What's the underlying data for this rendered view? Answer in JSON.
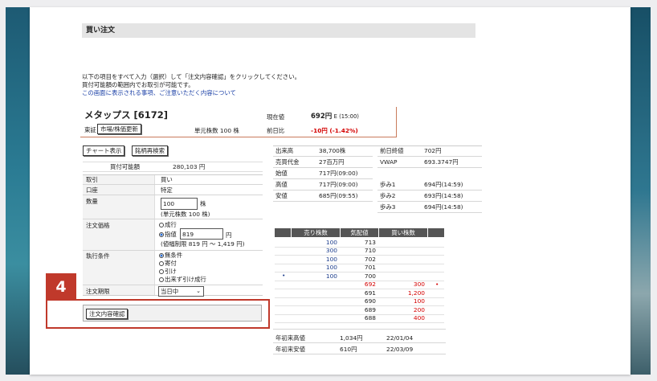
{
  "title": "買い注文",
  "intro": {
    "line1": "以下の項目をすべて入力（選択）して「注文内容確認」をクリックしてください。",
    "line2": "買付可能額の範囲内でお取引が可能です。",
    "link": "この画面に表示される事項、ご注意いただく内容について"
  },
  "stock": {
    "name": "メタップス [6172]",
    "market": "東証",
    "update_button": "市場/株価更新",
    "unit_label": "単元株数 100 株",
    "price_label": "現在値",
    "price_value": "692円",
    "price_sub": "E (15:00)",
    "change_label": "前日比",
    "change_value": "-10円 (-1.42%)"
  },
  "buttons": {
    "chart": "チャート表示",
    "search": "銘柄再検索",
    "confirm": "注文内容確認"
  },
  "form": {
    "available_label": "買付可能額",
    "available_value": "280,103 円",
    "trade_label": "取引",
    "trade_value": "買い",
    "account_label": "口座",
    "account_value": "特定",
    "qty_label": "数量",
    "qty_value": "100",
    "qty_unit": "株",
    "qty_note": "(単元株数 100 株)",
    "price_label": "注文価格",
    "market_option": "成行",
    "limit_option": "指値",
    "limit_value": "819",
    "price_unit": "円",
    "price_range": "(値幅制限 819 円 ～ 1,419 円)",
    "cond_label": "執行条件",
    "cond_options": [
      "無条件",
      "寄付",
      "引け",
      "出来ず引け成行"
    ],
    "period_label": "注文期限",
    "period_value": "当日中"
  },
  "stats": {
    "volume_label": "出来高",
    "volume": "38,700株",
    "turnover_label": "売買代金",
    "turnover": "27百万円",
    "open_label": "始値",
    "open": "717円(09:00)",
    "high_label": "高値",
    "high": "717円(09:00)",
    "low_label": "安値",
    "low": "685円(09:55)",
    "prevclose_label": "前日終値",
    "prevclose": "702円",
    "vwap_label": "VWAP",
    "vwap": "693.3747円",
    "tick1_label": "歩み1",
    "tick1": "694円(14:59)",
    "tick2_label": "歩み2",
    "tick2": "693円(14:58)",
    "tick3_label": "歩み3",
    "tick3": "694円(14:58)"
  },
  "board": {
    "headers": [
      "売り株数",
      "気配値",
      "買い株数"
    ],
    "rows": [
      {
        "sell": "100",
        "price": "713",
        "buy": ""
      },
      {
        "sell": "300",
        "price": "710",
        "buy": ""
      },
      {
        "sell": "100",
        "price": "702",
        "buy": ""
      },
      {
        "sell": "100",
        "price": "701",
        "buy": ""
      },
      {
        "sell": "100",
        "price": "700",
        "buy": ""
      },
      {
        "sell": "",
        "price": "692",
        "buy": "300"
      },
      {
        "sell": "",
        "price": "691",
        "buy": "1,200"
      },
      {
        "sell": "",
        "price": "690",
        "buy": "100"
      },
      {
        "sell": "",
        "price": "689",
        "buy": "200"
      },
      {
        "sell": "",
        "price": "688",
        "buy": "400"
      }
    ]
  },
  "ytd": {
    "high_label": "年初来高値",
    "high_value": "1,034円",
    "high_date": "22/01/04",
    "low_label": "年初来安値",
    "low_value": "610円",
    "low_date": "22/03/09"
  },
  "step_badge": "4",
  "colors": {
    "accent": "#c0392b",
    "header_bar": "#e4e4e4",
    "board_header": "#555555"
  }
}
